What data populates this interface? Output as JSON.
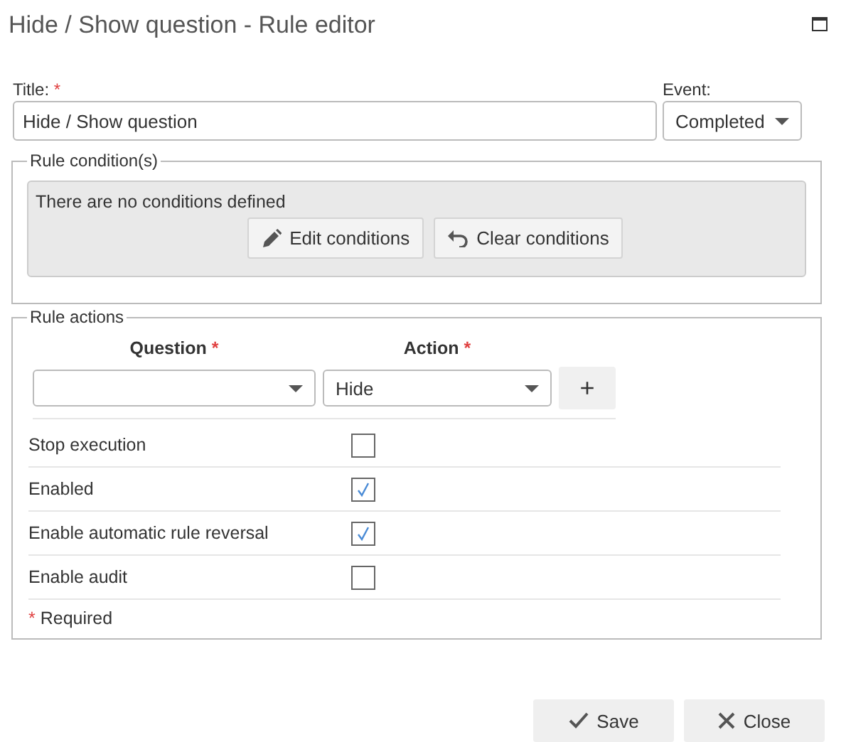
{
  "window": {
    "title": "Hide / Show question - Rule editor"
  },
  "title_field": {
    "label": "Title:",
    "mark": "*",
    "value": "Hide / Show question"
  },
  "event_field": {
    "label": "Event:",
    "value": "Completed"
  },
  "conditions": {
    "legend": "Rule condition(s)",
    "message": "There are no conditions defined",
    "buttons": [
      {
        "kind": "edit",
        "label": "Edit conditions"
      },
      {
        "kind": "clear",
        "label": "Clear conditions"
      }
    ]
  },
  "actions": {
    "legend": "Rule actions",
    "columns": [
      {
        "label": "Question",
        "mark": "*"
      },
      {
        "label": "Action",
        "mark": "*"
      }
    ],
    "action_value": "Hide",
    "add_button": "+",
    "options": [
      {
        "label": "Stop execution",
        "checked": false
      },
      {
        "label": "Enabled",
        "checked": true
      },
      {
        "label": "Enable automatic rule reversal",
        "checked": true
      },
      {
        "label": "Enable audit",
        "checked": false
      }
    ],
    "required_note": {
      "mark": "*",
      "text": "Required"
    }
  },
  "buttons": [
    {
      "kind": "save",
      "label": "Save"
    },
    {
      "kind": "close",
      "label": "Close"
    }
  ]
}
